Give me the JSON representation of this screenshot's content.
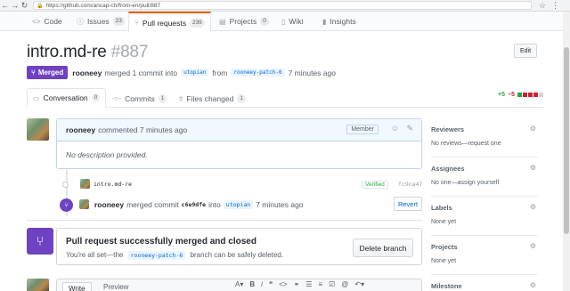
{
  "browser": {
    "url": "https://github.com/ancap-ch/from-en/pull/887"
  },
  "repo_tabs": [
    {
      "label": "Code",
      "count": null
    },
    {
      "label": "Issues",
      "count": "23"
    },
    {
      "label": "Pull requests",
      "count": "239"
    },
    {
      "label": "Projects",
      "count": "0"
    },
    {
      "label": "Wiki",
      "count": null
    },
    {
      "label": "Insights",
      "count": null
    }
  ],
  "pr": {
    "title": "intro.md-re",
    "number": "#887",
    "edit_label": "Edit",
    "state": "Merged",
    "author": "rooneey",
    "merge_text": "merged 1 commit into",
    "base_branch": "utopian",
    "from_text": "from",
    "head_branch": "rooneey-patch-6",
    "time": "7 minutes ago"
  },
  "pr_tabs": [
    {
      "label": "Conversation",
      "count": "0"
    },
    {
      "label": "Commits",
      "count": "1"
    },
    {
      "label": "Files changed",
      "count": "1"
    }
  ],
  "diffstat": {
    "additions": "+5",
    "deletions": "−5"
  },
  "comment": {
    "author": "rooneey",
    "action": "commented 7 minutes ago",
    "role": "Member",
    "body": "No description provided."
  },
  "commit": {
    "message": "intro.md-re",
    "verified": "Verified",
    "sha": "fc9ca47"
  },
  "merge_event": {
    "author": "rooneey",
    "text": "merged commit",
    "sha": "c6e9dfe",
    "into": "into",
    "branch": "utopian",
    "time": "7 minutes ago",
    "revert_label": "Revert"
  },
  "merged_box": {
    "title": "Pull request successfully merged and closed",
    "desc_before": "You're all set—the",
    "branch": "rooneey-patch-6",
    "desc_after": "branch can be safely deleted.",
    "delete_label": "Delete branch"
  },
  "composer": {
    "write": "Write",
    "preview": "Preview"
  },
  "sidebar": [
    {
      "title": "Reviewers",
      "value": "No reviews—request one"
    },
    {
      "title": "Assignees",
      "value": "No one—assign yourself"
    },
    {
      "title": "Labels",
      "value": "None yet"
    },
    {
      "title": "Projects",
      "value": "None yet"
    },
    {
      "title": "Milestone",
      "value": ""
    }
  ],
  "colors": {
    "merged": "#6f42c1",
    "accent_tab": "#e36209",
    "link": "#0366d6",
    "addition": "#28a745",
    "deletion": "#cb2431"
  }
}
